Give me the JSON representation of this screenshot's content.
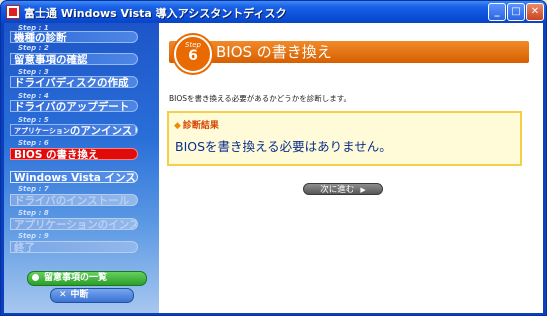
{
  "window": {
    "title": "富士通 Windows Vista 導入アシスタントディスク",
    "controls": {
      "minimize": "_",
      "maximize": "□",
      "close": "✕"
    }
  },
  "sidebar": {
    "steps": [
      {
        "tag": "Step : 1",
        "label": "機種の診断",
        "state": "done"
      },
      {
        "tag": "Step : 2",
        "label": "留意事項の確認",
        "state": "done"
      },
      {
        "tag": "Step : 3",
        "label": "ドライバディスクの作成",
        "state": "done"
      },
      {
        "tag": "Step : 4",
        "label": "ドライバのアップデート",
        "state": "done"
      },
      {
        "tag": "Step : 5",
        "label_small": "アプリケーション",
        "label": "のアンインストール",
        "state": "done"
      },
      {
        "tag": "Step : 6",
        "label": "BIOS の書き換え",
        "state": "current"
      },
      {
        "tag": "",
        "label": "Windows Vista インストール",
        "state": "vista"
      },
      {
        "tag": "Step : 7",
        "label": "ドライバのインストール",
        "state": "disabled"
      },
      {
        "tag": "Step : 8",
        "label": "アプリケーションのインストール",
        "state": "disabled"
      },
      {
        "tag": "Step : 9",
        "label": "終了",
        "state": "disabled"
      }
    ],
    "notes_button": "留意事項の一覧",
    "cancel_button": "中断"
  },
  "main": {
    "step_word": "Step",
    "step_number": "6",
    "title": "BIOS の書き換え",
    "description": "BIOSを書き換える必要があるかどうかを診断します。",
    "result_label": "診断結果",
    "result_text": "BIOSを書き換える必要はありません。",
    "next_button": "次に進む"
  },
  "colors": {
    "accent_orange": "#e86a00",
    "current_step_red": "#e00b0b",
    "result_text_blue": "#0b2e8a",
    "result_box_fill": "#fffbd9"
  }
}
